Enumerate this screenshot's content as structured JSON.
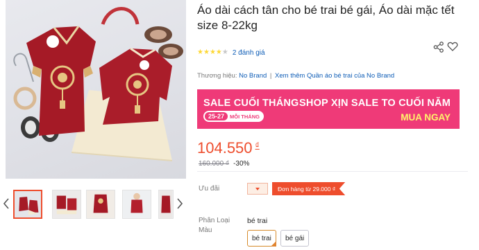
{
  "product": {
    "title": "Áo dài cách tân cho bé trai bé gái, Áo dài mặc tết size 8-22kg",
    "rating": {
      "stars": 4,
      "max": 5,
      "count_label": "2 đánh giá"
    },
    "brand": {
      "label": "Thương hiệu:",
      "name": "No Brand",
      "separator": "|",
      "more_link": "Xem thêm Quần áo bé trai của No Brand"
    },
    "price": {
      "current": "104.550",
      "currency": "₫",
      "original": "160.000 ₫",
      "discount": "-30%"
    }
  },
  "banner": {
    "left_title": "SALE CUỐI THÁNG",
    "date": "25-27",
    "date_suffix": "MỖI THÁNG",
    "right_title": "SHOP XỊN SALE TO CUỐI NĂM",
    "cta": "MUA NGAY"
  },
  "promo": {
    "label": "Ưu đãi",
    "coupon": "Đơn hàng từ 29.000 ₫"
  },
  "variant": {
    "label": "Phân Loại Màu",
    "selected_value": "bé trai",
    "options": [
      "bé trai",
      "bé gái"
    ]
  },
  "gallery": {
    "thumbnail_count": 5,
    "active_index": 0
  },
  "colors": {
    "accent": "#ee4d2d",
    "banner": "#ef3a78",
    "link": "#0d5cb6",
    "star": "#fdd836"
  },
  "icons": [
    "chevron-left-icon",
    "chevron-right-icon",
    "share-icon",
    "heart-icon",
    "star-icon"
  ]
}
